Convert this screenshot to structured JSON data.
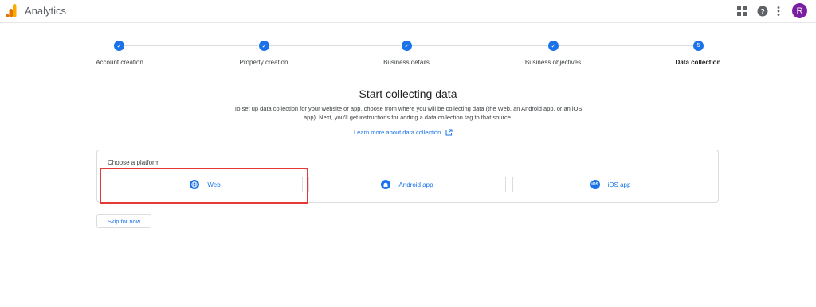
{
  "header": {
    "app_title": "Analytics",
    "icons": [
      "analytics-logo",
      "apps-icon",
      "help-icon",
      "more-vert-icon"
    ],
    "avatar_letter": "R",
    "avatar_color": "#7b1fa2"
  },
  "stepper": {
    "steps": [
      {
        "label": "Account creation",
        "state": "completed"
      },
      {
        "label": "Property creation",
        "state": "completed"
      },
      {
        "label": "Business details",
        "state": "completed"
      },
      {
        "label": "Business objectives",
        "state": "completed"
      },
      {
        "label": "Data collection",
        "state": "current",
        "number": "5"
      }
    ]
  },
  "main": {
    "title": "Start collecting data",
    "description": "To set up data collection for your website or app, choose from where you will be collecting data (the Web, an Android app, or an iOS app). Next, you'll get instructions for adding a data collection tag to that source.",
    "learn_more": "Learn more about data collection"
  },
  "platform": {
    "heading": "Choose a platform",
    "options": [
      {
        "label": "Web",
        "icon": "globe-icon"
      },
      {
        "label": "Android app",
        "icon": "android-icon"
      },
      {
        "label": "iOS app",
        "icon": "ios-icon",
        "icon_text": "iOS"
      }
    ]
  },
  "skip_label": "Skip for now",
  "colors": {
    "accent": "#1a73e8",
    "highlight": "#e53935",
    "logo_orange": "#f9ab00",
    "logo_dark": "#e37400"
  }
}
